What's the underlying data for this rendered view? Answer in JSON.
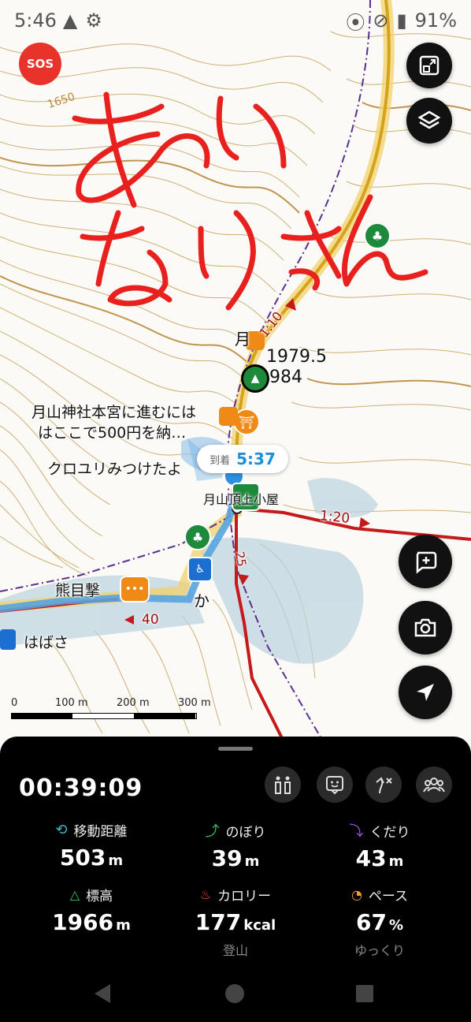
{
  "status_bar": {
    "time": "5:46",
    "battery": "91%"
  },
  "sos": {
    "label": "SOS"
  },
  "map": {
    "contour_label": "1650",
    "summit_elev_a": "1979.5",
    "summit_elev_b": "984",
    "label_tsukiyama_top": "月",
    "label_shrine": "月山神社本宮に進むには",
    "label_shrine_2": "はここで500円を納…",
    "label_kuroyuri": "クロユリみつけたよ",
    "label_hut": "月山頂上小屋",
    "label_kuma": "熊目撃",
    "label_ka": "か",
    "label_habasa": "はばさ",
    "time_1_10": "1:10",
    "time_1_20": "1:20",
    "time_40": "40",
    "time_25": "25",
    "handwriting": "あいなりさん",
    "arrival_label": "到着",
    "arrival_time": "5:37",
    "scale_labels": [
      "0",
      "100 m",
      "200 m",
      "300 m"
    ]
  },
  "panel": {
    "elapsed": "00:39:09",
    "stats": [
      {
        "label": "移動距離",
        "value": "503",
        "unit": "m",
        "sub": "",
        "color": "#3fb6c7"
      },
      {
        "label": "のぼり",
        "value": "39",
        "unit": "m",
        "sub": "",
        "color": "#33c06a"
      },
      {
        "label": "くだり",
        "value": "43",
        "unit": "m",
        "sub": "",
        "color": "#9b55e0"
      },
      {
        "label": "標高",
        "value": "1966",
        "unit": "m",
        "sub": "",
        "color": "#33c06a"
      },
      {
        "label": "カロリー",
        "value": "177",
        "unit": "kcal",
        "sub": "登山",
        "color": "#ee4b3a"
      },
      {
        "label": "ペース",
        "value": "67",
        "unit": "%",
        "sub": "ゆっくり",
        "color": "#f0a12a"
      }
    ]
  }
}
